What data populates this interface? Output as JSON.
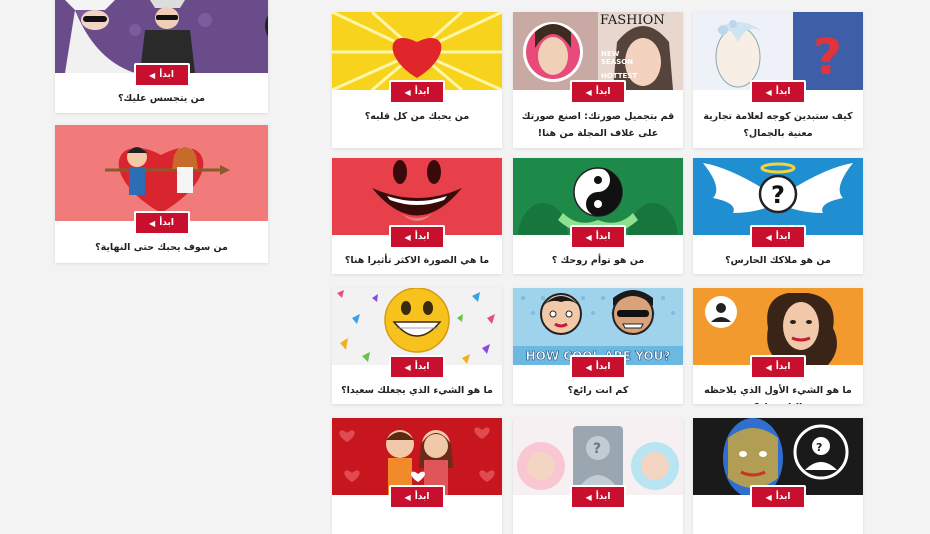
{
  "start_label": "ابدأ",
  "colors": {
    "accent": "#c8102e",
    "page_bg": "#f3f3f3"
  },
  "sidebar_cards": [
    {
      "title": "من يتجسس عليك؟",
      "thumb": "spy-thumbnail"
    },
    {
      "title": "من سوف يحبك حتى النهاية؟",
      "thumb": "love-couple-heart-thumbnail"
    }
  ],
  "grid_cards": [
    {
      "title": "كيف ستبدين كوجه لعلامة تجارية معنية بالجمال؟",
      "thumb": "woman-question-mark-thumbnail"
    },
    {
      "title": "قم بتجميل صورتك: اصنع صورتك على غلاف المجلة من هنا!",
      "thumb": "fashion-magazine-thumbnail",
      "overlay_text": [
        "FASHION",
        "NEW",
        "SEASON",
        "HOTTEST"
      ]
    },
    {
      "title": "من يحبك من كل قلبه؟",
      "thumb": "heart-sunburst-thumbnail"
    },
    {
      "title": "من هو ملاكك الحارس؟",
      "thumb": "angel-wings-thumbnail"
    },
    {
      "title": "من هو توأم روحك ؟",
      "thumb": "yin-yang-thumbnail"
    },
    {
      "title": "ما هي الصورة الاكثر تأثيرا هنا؟",
      "thumb": "red-smiley-thumbnail"
    },
    {
      "title": "ما هو الشيء الأول الذي يلاحظه الناس بك؟",
      "thumb": "woman-silhouette-thumbnail"
    },
    {
      "title": "كم انت رائع؟",
      "thumb": "pop-art-thumbnail",
      "overlay_text": [
        "HOW COOL ARE YOU?"
      ]
    },
    {
      "title": "ما هو الشيء الذي يجعلك سعيدا؟",
      "thumb": "yellow-smiley-thumbnail"
    },
    {
      "title": "",
      "thumb": "painted-face-thumbnail"
    },
    {
      "title": "",
      "thumb": "babies-thumbnail"
    },
    {
      "title": "",
      "thumb": "couple-hearts-thumbnail"
    }
  ]
}
